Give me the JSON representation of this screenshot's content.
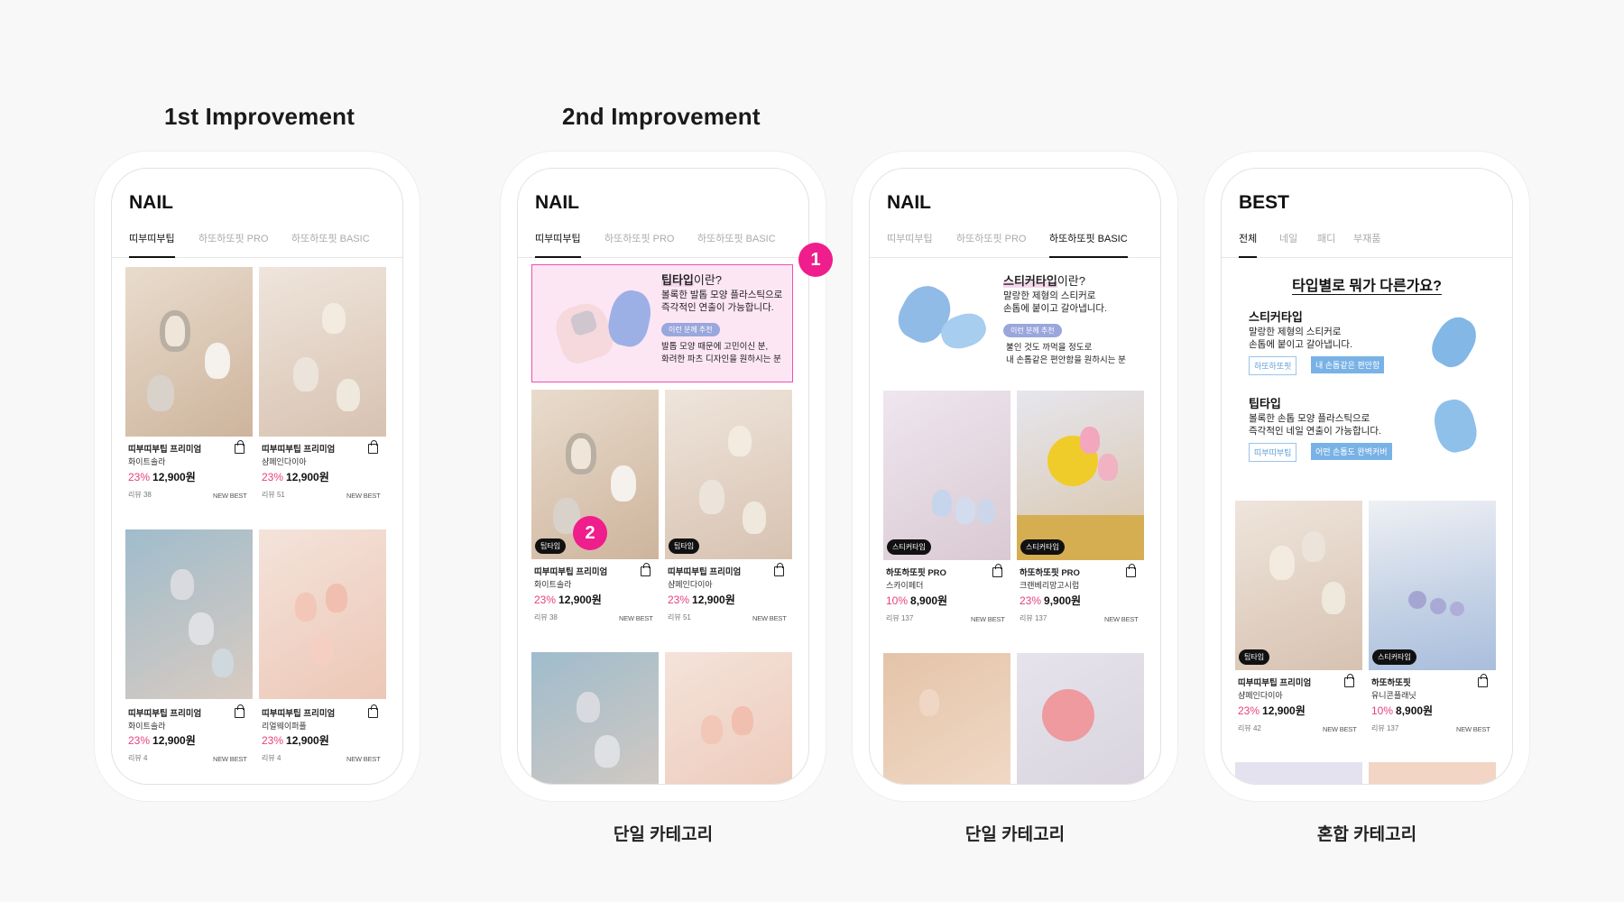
{
  "headings": {
    "first": "1st Improvement",
    "second": "2nd Improvement"
  },
  "captions": [
    "단일 카테고리",
    "단일 카테고리",
    "혼합 카테고리"
  ],
  "markers": [
    "1",
    "2"
  ],
  "phones": [
    {
      "title": "NAIL",
      "tabs": [
        {
          "label": "띠부띠부팁"
        },
        {
          "label": "하또하또핏 PRO"
        },
        {
          "label": "하또하또핏 BASIC"
        }
      ],
      "products": [
        {
          "name": "띠부띠부팁 프리미엄",
          "variant": "화이트솔라",
          "discount": "23%",
          "price": "12,900원",
          "reviews": "리뷰 38",
          "tags": "NEW BEST"
        },
        {
          "name": "띠부띠부팁 프리미엄",
          "variant": "샴페인다이아",
          "discount": "23%",
          "price": "12,900원",
          "reviews": "리뷰 51",
          "tags": "NEW BEST"
        },
        {
          "name": "띠부띠부팁 프리미엄",
          "variant": "화이트솔라",
          "discount": "23%",
          "price": "12,900원",
          "reviews": "리뷰 4",
          "tags": "NEW BEST"
        },
        {
          "name": "띠부띠부팁 프리미엄",
          "variant": "리얼웨이퍼플",
          "discount": "23%",
          "price": "12,900원",
          "reviews": "리뷰 4",
          "tags": "NEW BEST"
        }
      ]
    },
    {
      "title": "NAIL",
      "tabs": [
        {
          "label": "띠부띠부팁"
        },
        {
          "label": "하또하또핏 PRO"
        },
        {
          "label": "하또하또핏 BASIC"
        }
      ],
      "banner": {
        "title_bold": "팁타입",
        "title_rest": "이란?",
        "line1": "볼록한 발톱 모양 플라스틱으로",
        "line2": "즉각적인 연출이 가능합니다.",
        "pill": "이런 분께 추천",
        "line3": "발톱 모양 때문에 고민이신 분,",
        "line4": "화려한 파츠 디자인을 원하시는 분"
      },
      "products": [
        {
          "badge": "팁타입",
          "name": "띠부띠부팁 프리미엄",
          "variant": "화이트솔라",
          "discount": "23%",
          "price": "12,900원",
          "reviews": "리뷰 38",
          "tags": "NEW BEST"
        },
        {
          "badge": "팁타입",
          "name": "띠부띠부팁 프리미엄",
          "variant": "샴페인다이아",
          "discount": "23%",
          "price": "12,900원",
          "reviews": "리뷰 51",
          "tags": "NEW BEST"
        }
      ]
    },
    {
      "title": "NAIL",
      "tabs": [
        {
          "label": "띠부띠부팁"
        },
        {
          "label": "하또하또핏 PRO"
        },
        {
          "label": "하또하또핏 BASIC"
        }
      ],
      "banner": {
        "title_bold": "스티커타입",
        "title_rest": "이란?",
        "line1": "말랑한 제형의 스티커로",
        "line2": "손톱에 붙이고 갈아냅니다.",
        "pill": "이런 분께 추천",
        "line3": "불인 것도 까먹을 정도로",
        "line4": "내 손톱같은 편안함을 원하시는 분"
      },
      "products": [
        {
          "badge": "스티커타입",
          "name": "하또하또핏 PRO",
          "variant": "스카이페더",
          "discount": "10%",
          "price": "8,900원",
          "reviews": "리뷰 137",
          "tags": "NEW BEST"
        },
        {
          "badge": "스티커타입",
          "name": "하또하또핏 PRO",
          "variant": "크랜베리망고시럽",
          "discount": "23%",
          "price": "9,900원",
          "reviews": "리뷰 137",
          "tags": "NEW BEST"
        }
      ]
    },
    {
      "title": "BEST",
      "tabs": [
        {
          "label": "전체"
        },
        {
          "label": "네일"
        },
        {
          "label": "패디"
        },
        {
          "label": "부재품"
        }
      ],
      "guide": {
        "title": "타입별로 뭐가 다른가요?",
        "items": [
          {
            "name": "스티커타입",
            "line1": "말랑한 제형의 스티커로",
            "line2": "손톱에 붙이고 갈아냅니다.",
            "chip1": "하또하또핏",
            "chip2": "내 손톱같은 편안함"
          },
          {
            "name": "팁타입",
            "line1": "볼록한 손톱 모양 플라스틱으로",
            "line2": "즉각적인 네일 연출이 가능합니다.",
            "chip1": "띠부띠부팁",
            "chip2": "어떤 손톱도 완벽커버"
          }
        ]
      },
      "products": [
        {
          "badge": "팁타입",
          "name": "띠부띠부팁 프리미엄",
          "variant": "샴페인다이아",
          "discount": "23%",
          "price": "12,900원",
          "reviews": "리뷰 42",
          "tags": "NEW BEST"
        },
        {
          "badge": "스티커타입",
          "name": "하또하또핏",
          "variant": "유니콘플래닛",
          "discount": "10%",
          "price": "8,900원",
          "reviews": "리뷰 137",
          "tags": "NEW BEST"
        }
      ]
    }
  ],
  "colors": {
    "accent": "#e8407f",
    "marker": "#ef1e8c",
    "banner_bg": "#fde6f4",
    "banner_border": "#ef4fb0",
    "chip": "#79b2e6"
  }
}
